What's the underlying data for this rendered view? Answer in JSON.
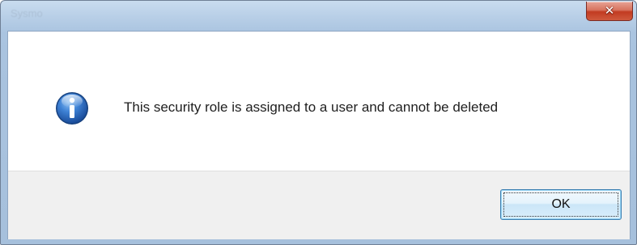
{
  "window": {
    "title": "Sysmo"
  },
  "title_bar": {
    "close_icon": "close-icon"
  },
  "dialog": {
    "icon": "info-icon",
    "message": "This security role is assigned to a user and cannot be deleted",
    "ok_label": "OK"
  },
  "colors": {
    "close_button": "#c23b22",
    "info_icon": "#1f5fb4",
    "button_area": "#f0f0f0",
    "ok_border": "#3c7fb1"
  }
}
